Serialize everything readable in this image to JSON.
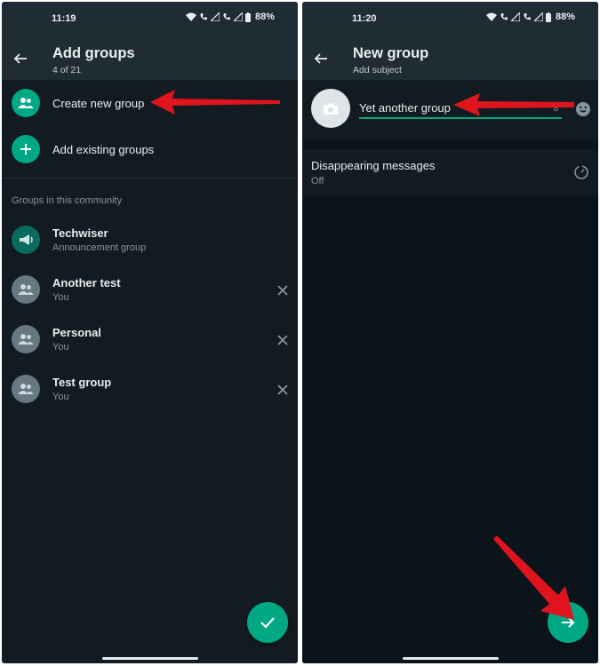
{
  "left_screen": {
    "status": {
      "time": "11:19",
      "battery": "88%"
    },
    "header": {
      "title": "Add groups",
      "subtitle": "4 of 21"
    },
    "actions": [
      {
        "label": "Create new group",
        "icon": "group-icon"
      },
      {
        "label": "Add existing groups",
        "icon": "plus-icon"
      }
    ],
    "section_label": "Groups in this community",
    "groups": [
      {
        "name": "Techwiser",
        "sub": "Announcement group",
        "icon": "megaphone-icon",
        "removable": false
      },
      {
        "name": "Another test",
        "sub": "You",
        "icon": "group-icon",
        "removable": true
      },
      {
        "name": "Personal",
        "sub": "You",
        "icon": "group-icon",
        "removable": true
      },
      {
        "name": "Test group",
        "sub": "You",
        "icon": "group-icon",
        "removable": true
      }
    ],
    "fab_icon": "check-icon"
  },
  "right_screen": {
    "status": {
      "time": "11:20",
      "battery": "88%"
    },
    "header": {
      "title": "New group",
      "subtitle": "Add subject"
    },
    "subject": {
      "value": "Yet another group",
      "remaining": "8"
    },
    "disappearing": {
      "title": "Disappearing messages",
      "value": "Off"
    },
    "fab_icon": "arrow-right-icon"
  },
  "colors": {
    "background": "#111b21",
    "header": "#202c33",
    "accent": "#00a884",
    "annotation_arrow": "#e0141e"
  }
}
